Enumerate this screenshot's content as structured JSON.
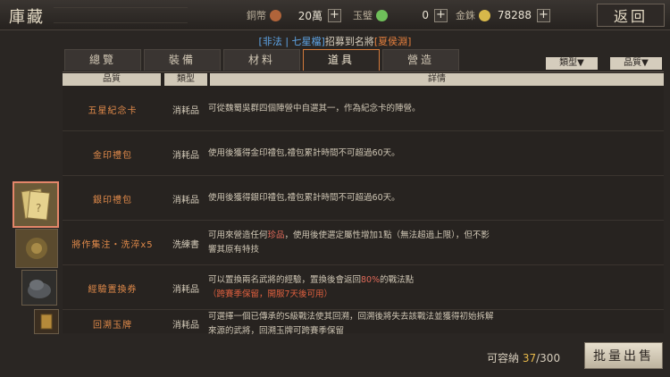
{
  "header": {
    "title": "庫藏",
    "back_label": "返回"
  },
  "currencies": [
    {
      "label": "銅幣",
      "value": "20萬",
      "coin_color": "#b0643a"
    },
    {
      "label": "玉璧",
      "value": "0",
      "coin_color": "#6fbf5a"
    },
    {
      "label": "金銖",
      "value": "78288",
      "coin_color": "#d7b84a"
    }
  ],
  "banner": {
    "bracket_text": "[非法 | 七星檔]",
    "mid_text": "招募到名將",
    "general": "[夏侯淵]"
  },
  "tabs": [
    {
      "label": "總覽",
      "active": false
    },
    {
      "label": "裝備",
      "active": false
    },
    {
      "label": "材料",
      "active": false
    },
    {
      "label": "道具",
      "active": true
    },
    {
      "label": "營造",
      "active": false
    }
  ],
  "filters": [
    {
      "label": "類型▼"
    },
    {
      "label": "品質▼"
    }
  ],
  "table": {
    "headers": {
      "quality": "品質",
      "type": "類型",
      "detail": "詳情"
    },
    "rows": [
      {
        "name": "五星紀念卡",
        "type": "消耗品",
        "desc_plain": "可從魏蜀吳群四個陣營中自選其一，作為紀念卡的陣營。"
      },
      {
        "name": "金印禮包",
        "type": "消耗品",
        "desc_plain": "使用後獲得金印禮包,禮包累計時間不可超過60天。"
      },
      {
        "name": "銀印禮包",
        "type": "消耗品",
        "desc_plain": "使用後獲得銀印禮包,禮包累計時間不可超過60天。"
      },
      {
        "name": "將作集注・洗淬x5",
        "type": "洗練書",
        "desc_a": "可用來營造任何",
        "desc_hl": "珍品",
        "desc_b": "，使用後使選定屬性增加1點（無法超過上限），但不影響其原有特技"
      },
      {
        "name": "經驗置換券",
        "type": "消耗品",
        "desc_a": "可以置換兩名武將的經驗，置換後會返回",
        "desc_hl": "80%",
        "desc_b": "的戰法點",
        "desc_c": "（跨賽季保留，開服7天後可用）"
      },
      {
        "name": "回溯玉牌",
        "type": "消耗品",
        "desc_plain": "可選擇一個已傳承的S級戰法使其回溯，回溯後將失去該戰法並獲得初始拆解來源的武將，回溯玉牌可跨賽季保留"
      }
    ]
  },
  "footer": {
    "capacity_label": "可容納",
    "capacity_used": "37",
    "capacity_sep": "/",
    "capacity_total": "300",
    "sell_label": "批量出售"
  }
}
